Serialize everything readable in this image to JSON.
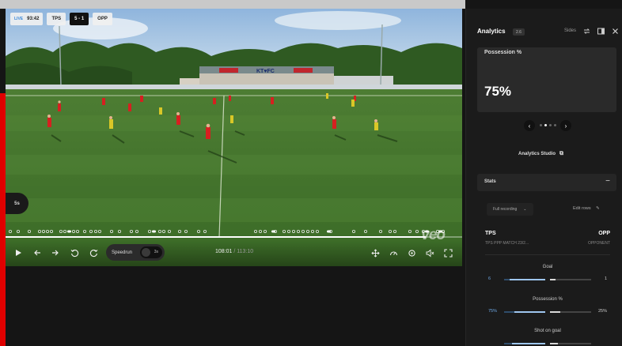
{
  "scoreboard": {
    "live_label": "LIVE",
    "clock": "93:42",
    "home": "TPS",
    "score": "5 - 1",
    "away": "OPP"
  },
  "video": {
    "speed_badge": "5s",
    "watermark": "veo",
    "progress_fraction": 0.92
  },
  "controls": {
    "speedrun_label": "Speedrun",
    "speedrun_toggle": "3s",
    "time_current": "108:01",
    "time_total": "113:10"
  },
  "panel": {
    "title": "Analytics",
    "badge": "2.6",
    "sides_label": "Sides",
    "possession_label": "Possession %",
    "possession_value": "75%",
    "studio_label": "Analytics Studio",
    "stats_label": "Stats",
    "filter_label": "Full recording",
    "edit_rows_label": "Edit rows",
    "home_team": "TPS",
    "away_team": "OPP",
    "home_sub": "TPS PPP MATCH 23/2...",
    "away_sub": "OPPONENT",
    "stats": [
      {
        "name": "Goal",
        "home": "6",
        "away": "1",
        "home_fraction": 0.86,
        "away_fraction": 0.14
      },
      {
        "name": "Possession %",
        "home": "75%",
        "away": "25%",
        "home_fraction": 0.75,
        "away_fraction": 0.25
      },
      {
        "name": "Shot on goal",
        "home": "",
        "away": "",
        "home_fraction": 0.8,
        "away_fraction": 0.2
      }
    ]
  },
  "colors": {
    "accent_blue": "#6ea9e6",
    "live_red": "#e00000"
  }
}
